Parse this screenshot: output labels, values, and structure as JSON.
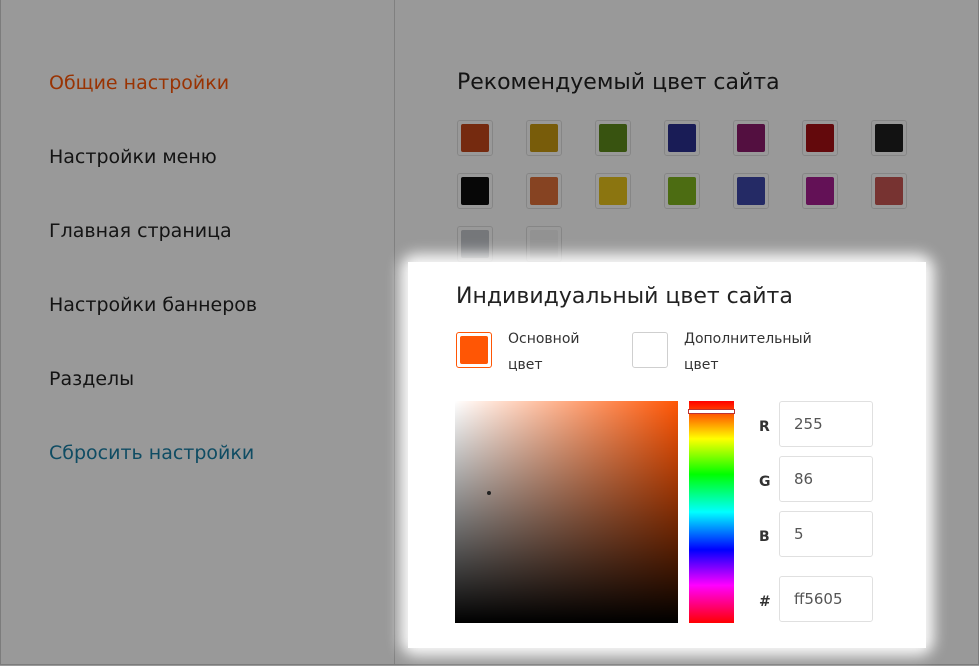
{
  "sidebar": {
    "items": [
      {
        "label": "Общие настройки",
        "active": true
      },
      {
        "label": "Настройки меню"
      },
      {
        "label": "Главная страница"
      },
      {
        "label": "Настройки баннеров"
      },
      {
        "label": "Разделы"
      }
    ],
    "reset_label": "Сбросить настройки"
  },
  "recommended": {
    "title": "Рекомендуемый цвет сайта",
    "colors": [
      "#c4461a",
      "#c99a12",
      "#5e8a1c",
      "#2a2f8f",
      "#8a1a6b",
      "#a50f14",
      "#1e1e1e",
      "#0c0c0c",
      "#e0713a",
      "#e8c41c",
      "#7fb51e",
      "#3c46a8",
      "#a61d90",
      "#c75553",
      "#c3c6cb",
      "#f4f4f4"
    ]
  },
  "custom": {
    "title": "Индивидуальный цвет сайта",
    "primary": {
      "label_line1": "Основной",
      "label_line2": "цвет",
      "color": "#ff5605"
    },
    "secondary": {
      "label_line1": "Дополнительный",
      "label_line2": "цвет",
      "color": "#ffffff"
    },
    "hue_color": "#ff5605",
    "rgb": {
      "r_label": "R",
      "r": "255",
      "g_label": "G",
      "g": "86",
      "b_label": "B",
      "b": "5"
    },
    "hex_label": "#",
    "hex": "ff5605"
  }
}
